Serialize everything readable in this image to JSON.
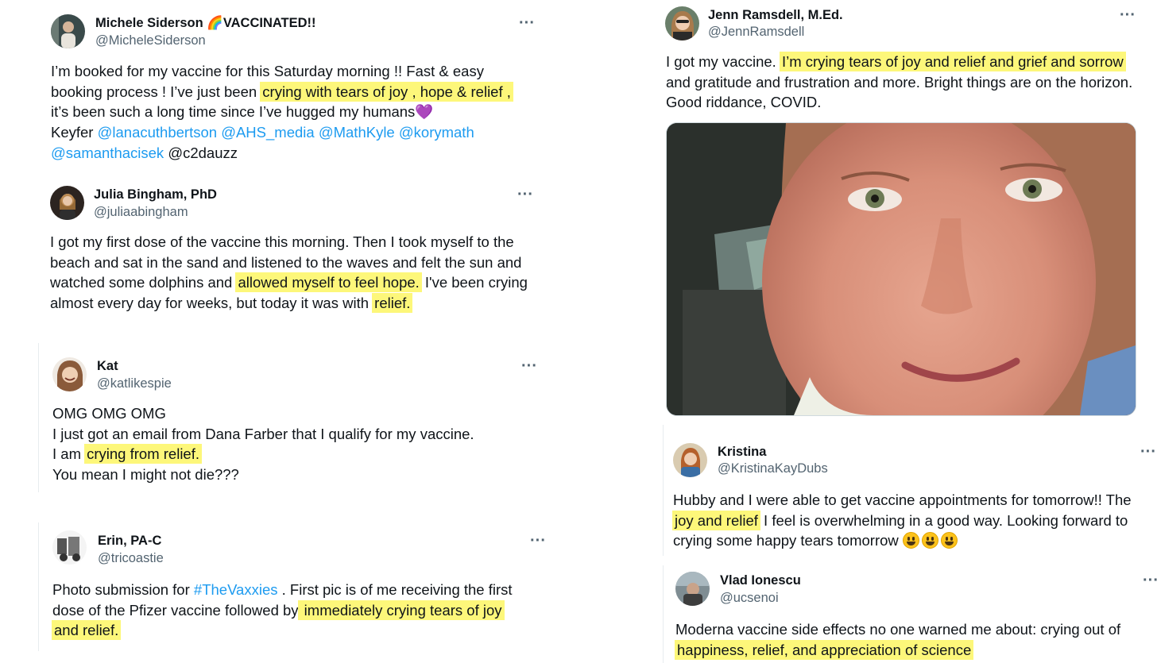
{
  "tweets": [
    {
      "name": "Michele Siderson 🌈VACCINATED!!",
      "handle": "@MicheleSiderson",
      "more": "···",
      "line1": "I’m booked for my vaccine for this Saturday morning !! Fast & easy",
      "line2a": "booking process ! I’ve just been ",
      "line2hl": "crying with tears of joy , hope & relief ,",
      "line3": "it’s been such a long time since I’ve hugged my humans",
      "heart": "💜",
      "line4a": "Keyfer ",
      "mention1": "@lanacuthbertson",
      "mention2": "@AHS_media",
      "mention3": "@MathKyle",
      "mention4": "@korymath",
      "mention5": "@samanthacisek",
      "line5b": " @c2dauzz"
    },
    {
      "name": "Julia Bingham, PhD",
      "handle": "@juliaabingham",
      "more": "···",
      "line1": "I got my first dose of the vaccine this morning. Then I took myself to the",
      "line2": "beach and sat in the sand and listened to the waves and felt the sun and",
      "line3a": "watched some dolphins and ",
      "line3hl": "allowed myself to feel hope.",
      "line3b": " I've been crying",
      "line4a": "almost every day for weeks, but today it was with ",
      "line4hl": "relief."
    },
    {
      "name": "Kat",
      "handle": "@katlikespie",
      "more": "···",
      "line1": "OMG OMG OMG",
      "line2": "I just got an email from Dana Farber that I qualify for my vaccine.",
      "line3a": "I am ",
      "line3hl": "crying from relief. ",
      "line4": "You mean I might not die???"
    },
    {
      "name": "Erin, PA-C",
      "handle": "@tricoastie",
      "more": "···",
      "line1a": "Photo submission for ",
      "hashtag": "#TheVaxxies",
      "line1b": " . First pic is of me receiving the first",
      "line2a": "dose of the Pfizer vaccine followed by",
      "line2hl": " immediately crying tears of joy ",
      "line3hl": "and relief. "
    },
    {
      "name": "Jenn Ramsdell, M.Ed.",
      "handle": "@JennRamsdell",
      "more": "···",
      "line1a": "I got my vaccine. ",
      "line1hl": "I’m crying tears of joy and relief and grief and sorrow ",
      "line2": "and gratitude and frustration and more. Bright things are on the horizon.",
      "line3": "Good riddance, COVID."
    },
    {
      "name": "Kristina",
      "handle": "@KristinaKayDubs",
      "more": "···",
      "line1": "Hubby and I were able to get vaccine appointments for tomorrow!! The",
      "line2hl": "joy and relief",
      "line2b": " I feel is overwhelming in a good way. Looking forward to",
      "line3": "crying some happy tears tomorrow "
    },
    {
      "name": "Vlad Ionescu",
      "handle": "@ucsenoi",
      "more": "···",
      "line1": "Moderna vaccine side effects no one warned me about: crying out of",
      "line2hl": "happiness, relief, and appreciation of science "
    }
  ]
}
